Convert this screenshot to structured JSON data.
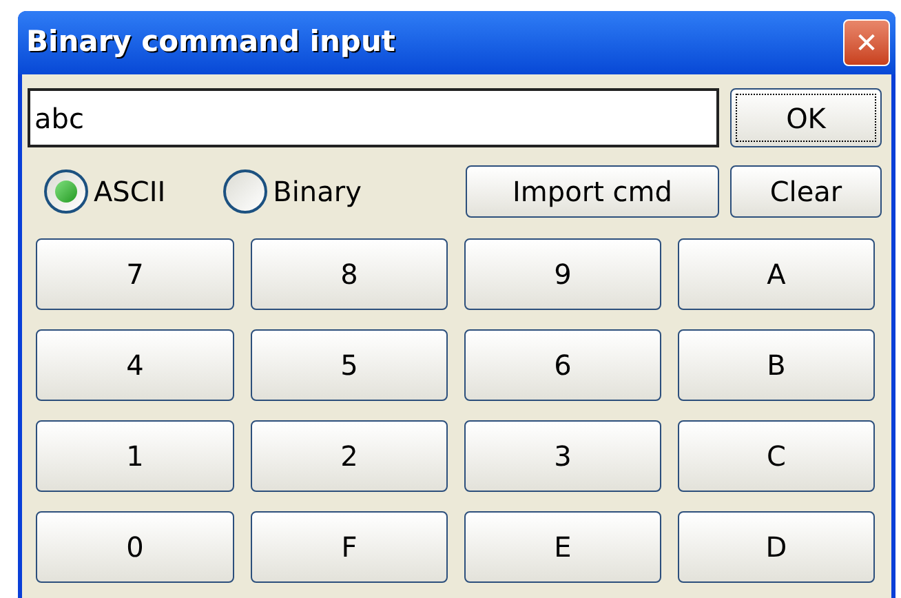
{
  "window": {
    "title": "Binary command input",
    "close": "✕"
  },
  "input": {
    "value": "abc"
  },
  "ok_button": {
    "label": "OK",
    "focused": true
  },
  "modes": [
    {
      "label": "ASCII",
      "selected": true
    },
    {
      "label": "Binary",
      "selected": false
    }
  ],
  "import_button": "Import cmd",
  "clear_button": "Clear",
  "keys": [
    "7",
    "8",
    "9",
    "A",
    "4",
    "5",
    "6",
    "B",
    "1",
    "2",
    "3",
    "C",
    "0",
    "F",
    "E",
    "D"
  ]
}
